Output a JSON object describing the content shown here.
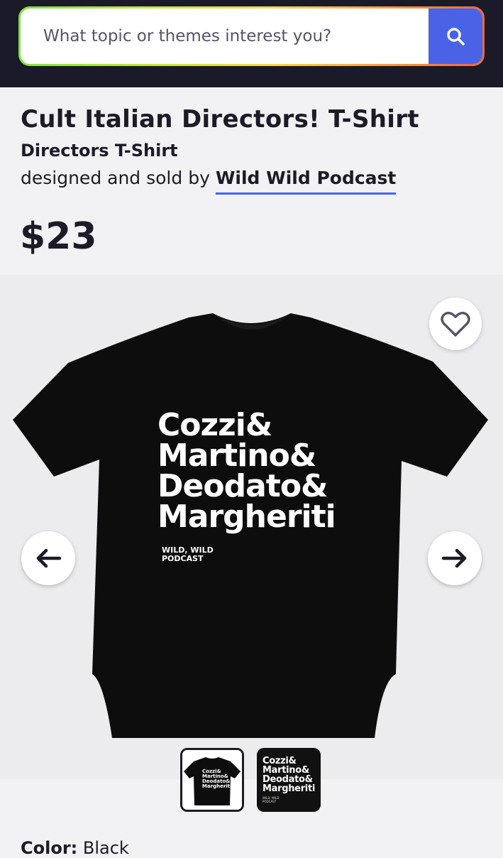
{
  "search": {
    "placeholder": "What topic or themes interest you?"
  },
  "product": {
    "title": "Cult Italian Directors! T-Shirt",
    "subtitle": "Directors T-Shirt",
    "byline_prefix": "designed and sold by",
    "designer": "Wild Wild Podcast",
    "price": "$23"
  },
  "design": {
    "lines": [
      "Cozzi&",
      "Martino&",
      "Deodato&",
      "Margheriti"
    ],
    "logo_lines": [
      "WILD, WILD",
      "PODCAST"
    ]
  },
  "selected_options": {
    "color_label": "Color:",
    "color_value": "Black"
  },
  "icons": {
    "search": "search-icon",
    "favorite": "heart-icon",
    "prev": "arrow-left-icon",
    "next": "arrow-right-icon"
  },
  "colors": {
    "header_bg": "#1b1a28",
    "accent": "#4a63e6",
    "shirt": "#0d0d0d"
  }
}
